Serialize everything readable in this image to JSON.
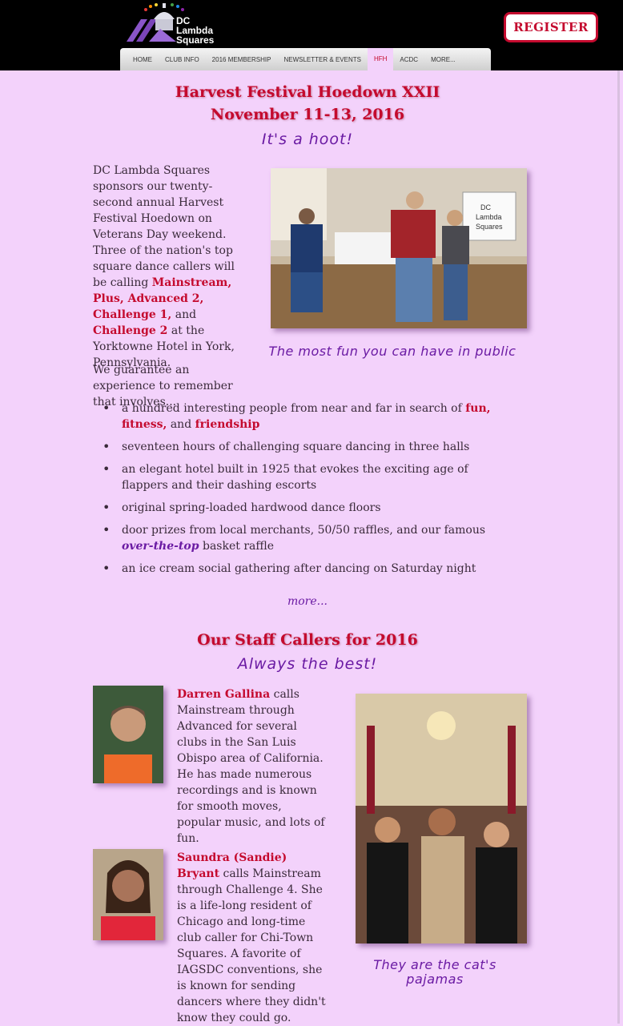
{
  "header": {
    "logo_text": [
      "DC",
      "Lambda",
      "Squares"
    ],
    "register_label": "REGISTER",
    "nav": [
      "HOME",
      "CLUB INFO",
      "2016 MEMBERSHIP",
      "NEWSLETTER & EVENTS",
      "HFH",
      "ACDC",
      "MORE..."
    ],
    "active_nav": "HFH"
  },
  "festival": {
    "title": "Harvest Festival Hoedown XXII",
    "dates": "November 11-13, 2016",
    "tagline": "It's a hoot!",
    "intro_a": "DC Lambda Squares sponsors our twenty-second annual Harvest Festival Hoedown on Veterans Day weekend. Three of the nation's top square dance callers will be calling ",
    "levels_1": "Mainstream, Plus, Advanced 2, Challenge 1,",
    "intro_and": " and ",
    "levels_2": "Challenge 2",
    "intro_b": " at the Yorktowne Hotel in York, Pennsylvania.",
    "guarantee": "We guarantee an experience to remember that involves...",
    "photo_caption": "The most fun you can have in public",
    "banner_text": [
      "DC",
      "Lambda",
      "Squares"
    ]
  },
  "bullets": {
    "b1_a": "a hundred interesting people from near and far in search of ",
    "b1_fun": "fun,",
    "b1_fitness": "fitness,",
    "b1_and": " and ",
    "b1_friendship": "friendship",
    "b2": "seventeen hours of challenging square dancing in three halls",
    "b3": "an elegant hotel built in 1925 that evokes the exciting age of flappers and their dashing escorts",
    "b4": "original spring-loaded hardwood dance floors",
    "b5_a": "door prizes from local merchants, 50/50 raffles, and our famous ",
    "b5_em": "over-the-top",
    "b5_b": " basket raffle",
    "b6": "an ice cream social gathering after dancing on Saturday night"
  },
  "more_link": "more...",
  "staff": {
    "title": "Our Staff Callers for 2016",
    "tagline": "Always the best!",
    "caller1_name": "Darren Gallina",
    "caller1_bio": " calls Mainstream through Advanced for several clubs in the San Luis Obispo area of California. He has made numerous recordings and is known for smooth moves, popular music, and lots of fun.",
    "caller2_name": "Saundra (Sandie) Bryant",
    "caller2_bio": " calls Mainstream through Challenge 4. She is a life-long resident of Chicago and long-time club caller for Chi-Town Squares. A favorite of IAGSDC conventions, she is known for sending dancers where they didn't know they could go.",
    "group_caption": "They are the cat's pajamas"
  },
  "colors": {
    "accent_red": "#c40a2e",
    "accent_purple": "#6a1aa3",
    "page_bg": "#f3d2fb"
  }
}
